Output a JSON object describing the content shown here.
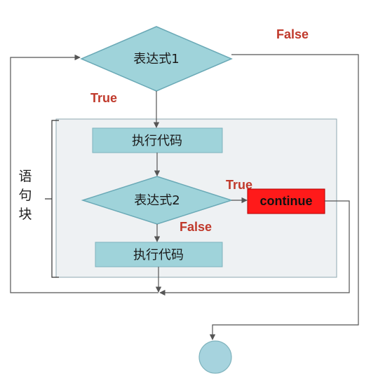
{
  "diagram": {
    "decision1": {
      "label": "表达式1"
    },
    "decision2": {
      "label": "表达式2"
    },
    "process1": {
      "label": "执行代码"
    },
    "process2": {
      "label": "执行代码"
    },
    "continue_box": {
      "label": "continue"
    },
    "labels": {
      "false_top": "False",
      "true_top": "True",
      "true_inner": "True",
      "false_inner": "False"
    },
    "block_label": [
      "语",
      "句",
      "块"
    ]
  },
  "colors": {
    "diamond_fill": "#9fd3da",
    "diamond_stroke": "#6aa9b6",
    "process_fill": "#9fd3da",
    "process_stroke": "#7fb3bd",
    "continue_fill": "#ff1a1a",
    "block_fill": "#eef1f3",
    "line": "#555555",
    "condition_text": "#c0392b",
    "terminal_fill": "#a6d3de"
  }
}
